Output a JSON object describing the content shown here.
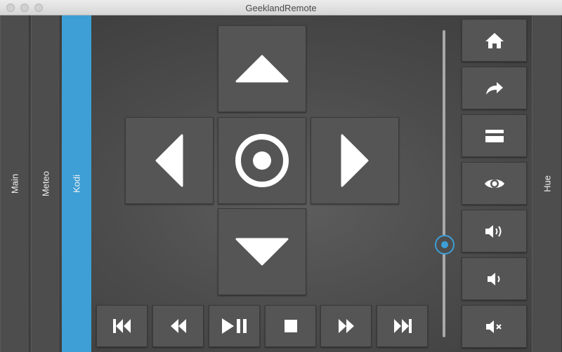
{
  "window": {
    "title": "GeeklandRemote"
  },
  "tabs": {
    "left": [
      "Main",
      "Meteo",
      "Kodi"
    ],
    "right": "Hue",
    "active": "Kodi"
  },
  "dpad": {
    "up": "triangle-up-icon",
    "left": "triangle-left-icon",
    "center": "select-circle-icon",
    "right": "triangle-right-icon",
    "down": "triangle-down-icon"
  },
  "transport": [
    "skip-previous-icon",
    "rewind-icon",
    "play-pause-icon",
    "stop-icon",
    "fast-forward-icon",
    "skip-next-icon"
  ],
  "side_buttons": [
    "home-icon",
    "share-icon",
    "card-icon",
    "eye-icon",
    "volume-up-icon",
    "volume-down-icon",
    "volume-mute-icon"
  ],
  "volume": {
    "level": 0.25
  },
  "colors": {
    "accent": "#3d9fd6",
    "button": "#555555",
    "background": "#4c4c4c"
  }
}
